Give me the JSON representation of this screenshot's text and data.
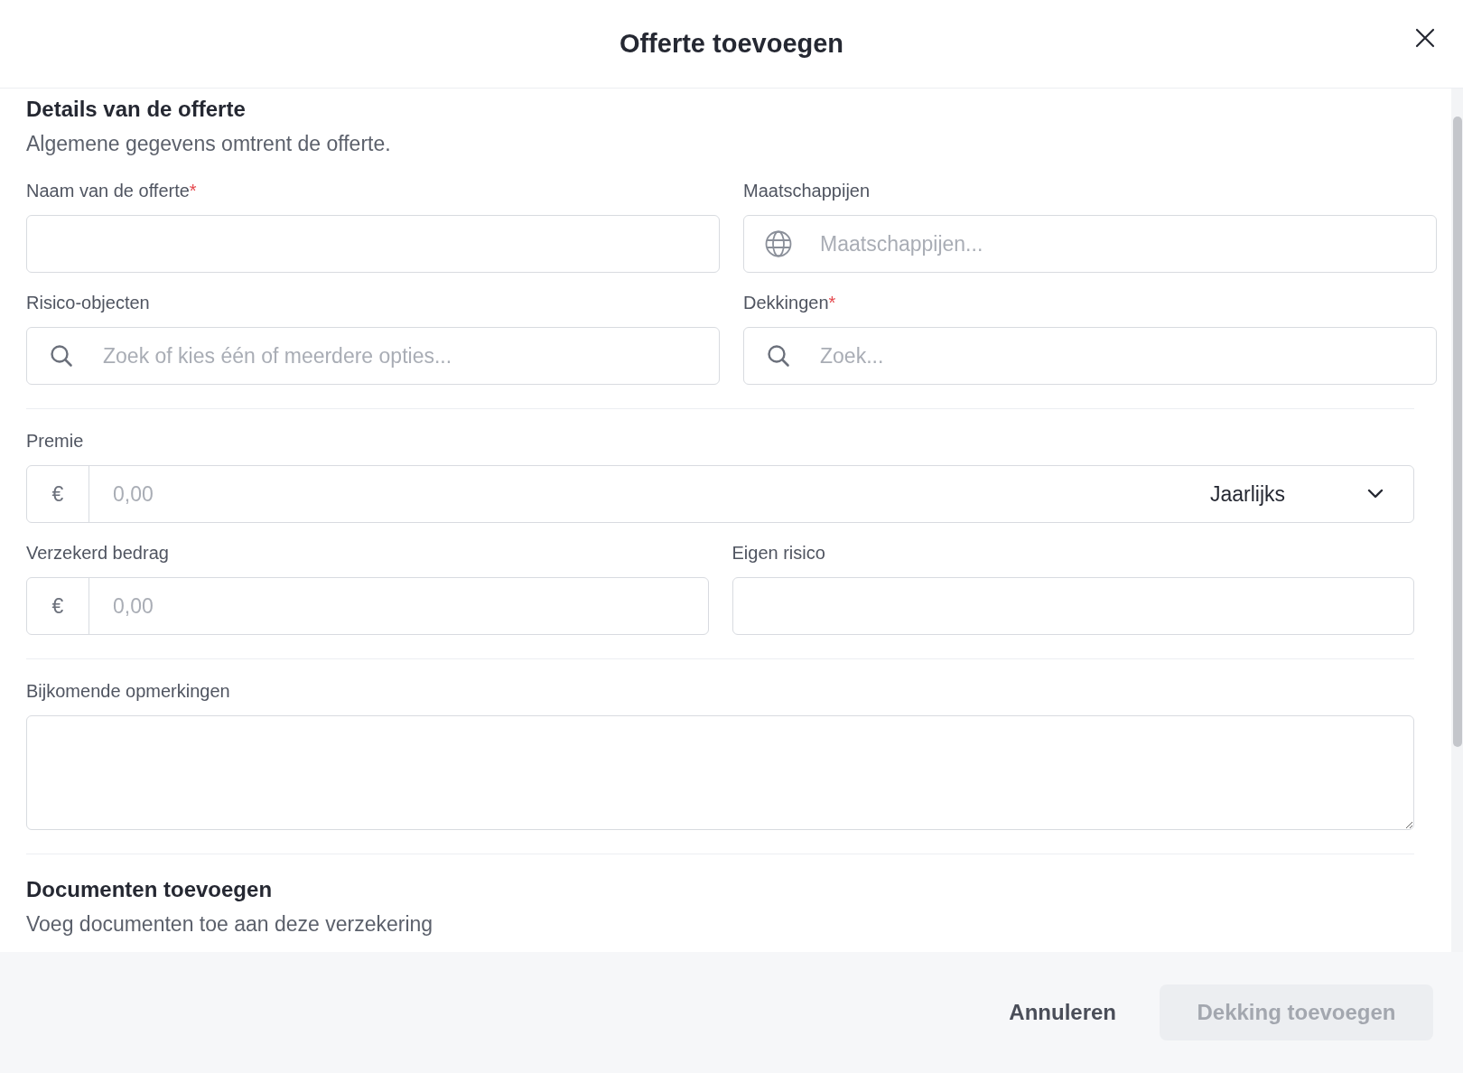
{
  "dialog": {
    "title": "Offerte toevoegen"
  },
  "details": {
    "title": "Details van de offerte",
    "subtitle": "Algemene gegevens omtrent de offerte."
  },
  "groups": [
    {
      "rows": [
        [
          {
            "kind": "text",
            "label": "Naam van de offerte",
            "required_mark": "*"
          },
          {
            "kind": "company",
            "label": "Maatschappijen",
            "placeholder": "Maatschappijen..."
          }
        ],
        [
          {
            "kind": "search",
            "label": "Risico-objecten",
            "placeholder": "Zoek of kies één of meerdere opties..."
          },
          {
            "kind": "search",
            "label": "Dekkingen",
            "required_mark": "*",
            "placeholder": "Zoek..."
          }
        ]
      ]
    },
    {
      "rows": [
        [
          {
            "kind": "premium",
            "label": "Premie",
            "prefix": "€",
            "placeholder": "0,00",
            "period": "Jaarlijks"
          }
        ],
        [
          {
            "kind": "amount",
            "label": "Verzekerd bedrag",
            "prefix": "€",
            "placeholder": "0,00"
          },
          {
            "kind": "text",
            "label": "Eigen risico"
          }
        ]
      ]
    },
    {
      "rows": [
        [
          {
            "kind": "textarea",
            "label": "Bijkomende opmerkingen"
          }
        ]
      ]
    }
  ],
  "documents": {
    "title": "Documenten toevoegen",
    "subtitle": "Voeg documenten toe aan deze verzekering"
  },
  "footer": {
    "cancel": "Annuleren",
    "submit": {
      "label": "Dekking toevoegen",
      "disabled": true
    }
  }
}
